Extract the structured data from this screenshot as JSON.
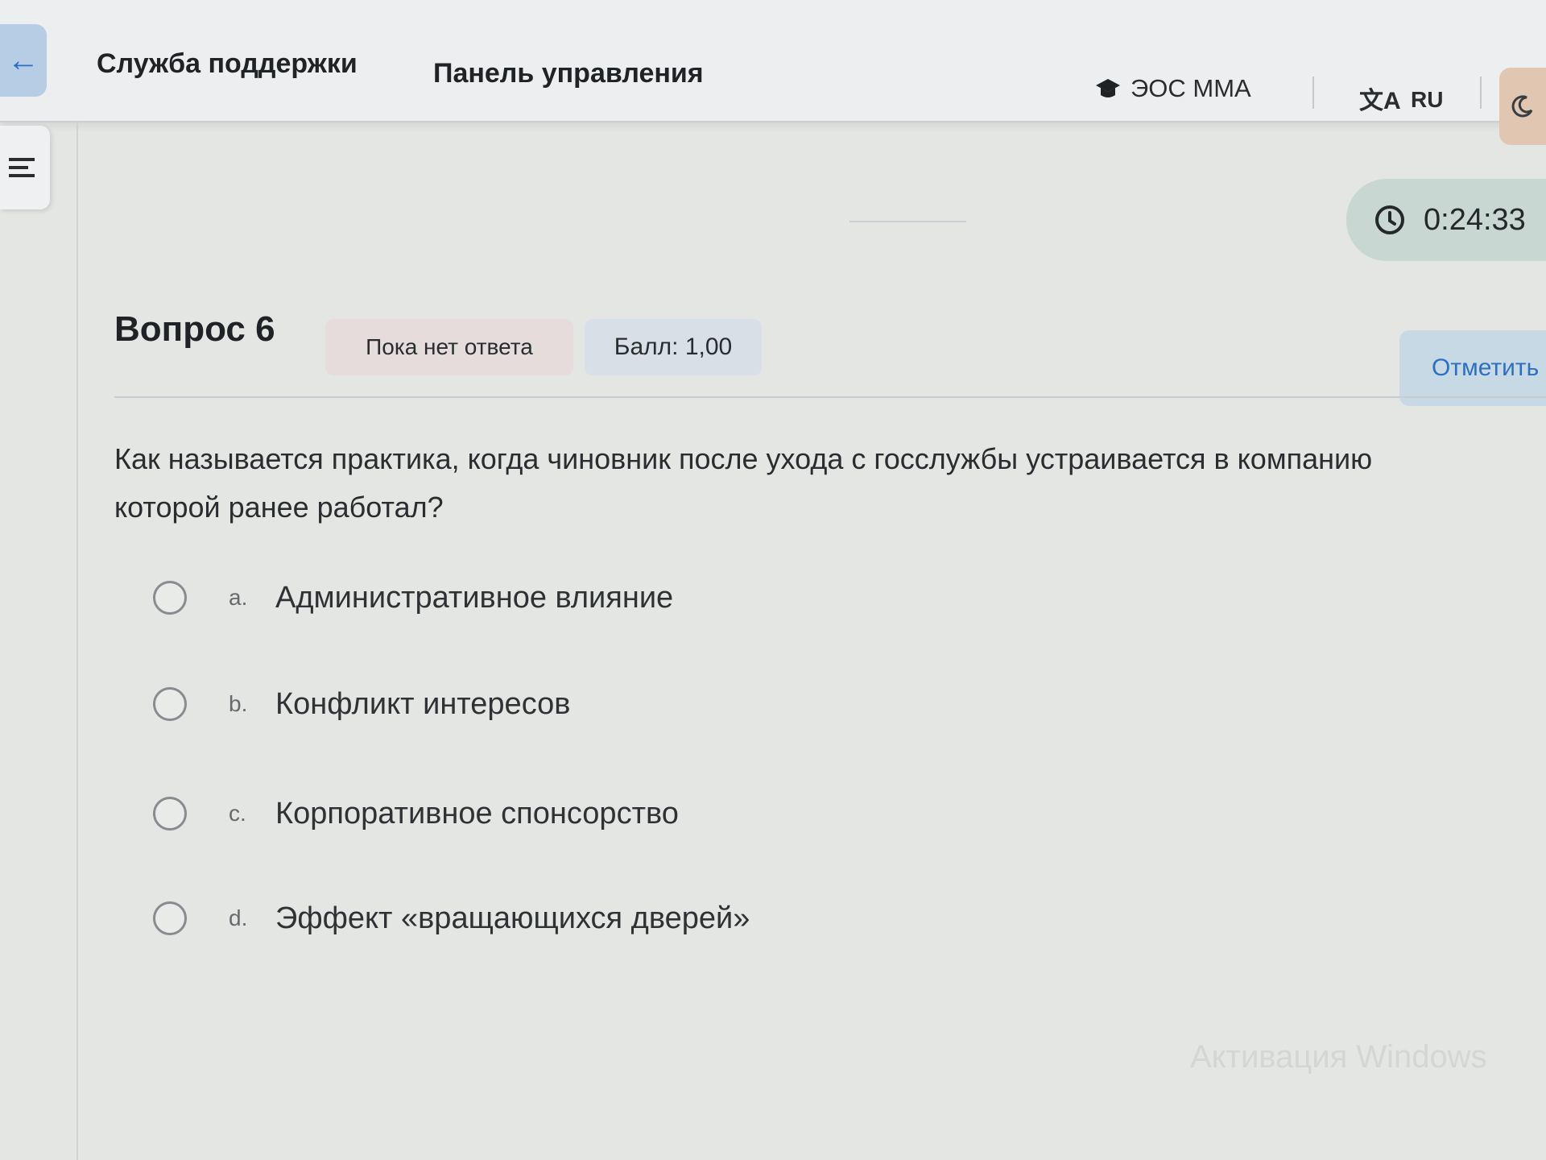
{
  "header": {
    "support_link": "Служба поддержки",
    "dashboard_link": "Панель управления",
    "brand": "ЭОС ММА",
    "language": "RU"
  },
  "timer": {
    "time": "0:24:33"
  },
  "question": {
    "title": "Вопрос 6",
    "status": "Пока нет ответа",
    "score": "Балл: 1,00",
    "flag_button": "Отметить",
    "text_line1": "Как называется практика, когда чиновник после ухода с госслужбы устраивается в компанию",
    "text_line2": "которой ранее работал?",
    "answers": [
      {
        "letter": "a.",
        "text": "Административное влияние"
      },
      {
        "letter": "b.",
        "text": "Конфликт интересов"
      },
      {
        "letter": "c.",
        "text": "Корпоративное спонсорство"
      },
      {
        "letter": "d.",
        "text": "Эффект «вращающихся дверей»"
      }
    ]
  },
  "watermark": "Активация Windows",
  "colors": {
    "accent": "#2d6fc0",
    "timer_bg": "#c8d7d2"
  },
  "icons": [
    "arrow-left-icon",
    "graduation-cap-icon",
    "translate-icon",
    "moon-icon",
    "hamburger-icon",
    "clock-icon"
  ]
}
